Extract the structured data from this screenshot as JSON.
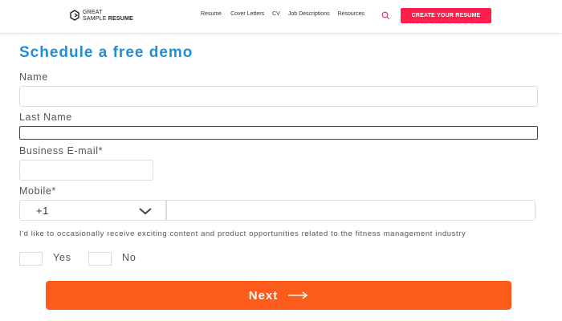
{
  "header": {
    "logo": {
      "line1": "GREAT",
      "line2a": "SAMPLE ",
      "line2b": "RESUME"
    },
    "nav": [
      "Resume",
      "Cover Letters",
      "CV",
      "Job Descriptions",
      "Resources"
    ],
    "search_icon": "search-icon",
    "cta_label": "CREATE YOUR RESUME"
  },
  "form": {
    "title": "Schedule a free demo",
    "name_label": "Name",
    "name_value": "",
    "last_name_label": "Last Name",
    "last_name_value": "",
    "email_label": "Business E-mail*",
    "email_value": "",
    "mobile_label": "Mobile*",
    "country_code": "+1",
    "mobile_value": "",
    "consent_text": "I'd like to occasionally receive exciting content and product opportunities related to the fitness management industry",
    "yes_label": "Yes",
    "no_label": "No",
    "next_label": "Next"
  },
  "colors": {
    "title": "#1f8fd8",
    "cta": "#ff1e4c",
    "next_button": "#fd5b1c"
  }
}
